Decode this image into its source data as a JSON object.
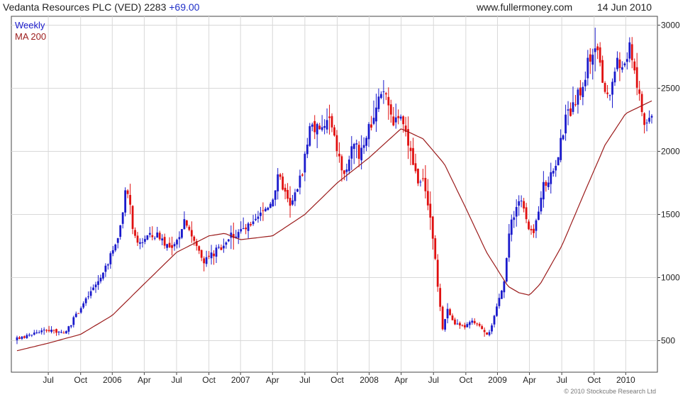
{
  "header": {
    "title": "Vedanta Resources PLC (VED) 2283",
    "change": "+69.00",
    "website": "www.fullermoney.com",
    "date": "14 Jun 2010"
  },
  "colors": {
    "up": "#1a1acc",
    "down": "#e01010",
    "ma": "#9b1b1b",
    "grid": "#d8d8d8",
    "axis": "#444444"
  },
  "chart_data": {
    "type": "candlestick",
    "legend": [
      {
        "label": "Weekly",
        "color": "#1a1acc"
      },
      {
        "label": "MA 200",
        "color": "#9b1b1b"
      }
    ],
    "y_ticks": [
      500,
      1000,
      1500,
      2000,
      2500,
      3000
    ],
    "ylim": [
      250,
      3070
    ],
    "x_ticks": [
      "Jul",
      "Oct",
      "2006",
      "Apr",
      "Jul",
      "Oct",
      "2007",
      "Apr",
      "Jul",
      "Oct",
      "2008",
      "Apr",
      "Jul",
      "Oct",
      "2009",
      "Apr",
      "Jul",
      "Oct",
      "2010",
      "Apr"
    ],
    "x_start": "2005-07-04",
    "x_end": "2010-06-14",
    "price_path": [
      [
        "2005-07-04",
        510
      ],
      [
        "2005-09-01",
        570
      ],
      [
        "2005-10-10",
        590
      ],
      [
        "2005-11-15",
        550
      ],
      [
        "2006-01-10",
        800
      ],
      [
        "2006-03-10",
        1050
      ],
      [
        "2006-04-20",
        1350
      ],
      [
        "2006-05-12",
        1700
      ],
      [
        "2006-06-08",
        1250
      ],
      [
        "2006-07-10",
        1330
      ],
      [
        "2006-08-15",
        1330
      ],
      [
        "2006-09-20",
        1200
      ],
      [
        "2006-10-25",
        1480
      ],
      [
        "2006-11-20",
        1280
      ],
      [
        "2006-12-20",
        1140
      ],
      [
        "2007-01-25",
        1220
      ],
      [
        "2007-03-10",
        1350
      ],
      [
        "2007-05-01",
        1400
      ],
      [
        "2007-06-25",
        1600
      ],
      [
        "2007-07-20",
        1800
      ],
      [
        "2007-08-20",
        1550
      ],
      [
        "2007-09-20",
        1800
      ],
      [
        "2007-10-20",
        2250
      ],
      [
        "2007-11-10",
        2150
      ],
      [
        "2007-12-10",
        2250
      ],
      [
        "2008-01-20",
        1800
      ],
      [
        "2008-02-10",
        2000
      ],
      [
        "2008-03-05",
        2000
      ],
      [
        "2008-04-10",
        2250
      ],
      [
        "2008-05-15",
        2500
      ],
      [
        "2008-06-05",
        2250
      ],
      [
        "2008-06-25",
        2300
      ],
      [
        "2008-07-15",
        2100
      ],
      [
        "2008-08-15",
        1800
      ],
      [
        "2008-09-10",
        1700
      ],
      [
        "2008-10-01",
        1300
      ],
      [
        "2008-10-15",
        850
      ],
      [
        "2008-10-27",
        600
      ],
      [
        "2008-11-10",
        750
      ],
      [
        "2008-11-25",
        650
      ],
      [
        "2008-12-20",
        600
      ],
      [
        "2009-01-20",
        650
      ],
      [
        "2009-02-15",
        600
      ],
      [
        "2009-03-05",
        550
      ],
      [
        "2009-03-25",
        700
      ],
      [
        "2009-04-20",
        1000
      ],
      [
        "2009-05-10",
        1450
      ],
      [
        "2009-06-05",
        1650
      ],
      [
        "2009-07-01",
        1350
      ],
      [
        "2009-07-15",
        1350
      ],
      [
        "2009-08-05",
        1700
      ],
      [
        "2009-09-01",
        1800
      ],
      [
        "2009-09-25",
        2000
      ],
      [
        "2009-10-15",
        2300
      ],
      [
        "2009-11-10",
        2350
      ],
      [
        "2009-12-15",
        2700
      ],
      [
        "2010-01-05",
        2850
      ],
      [
        "2010-01-25",
        2550
      ],
      [
        "2010-02-10",
        2400
      ],
      [
        "2010-03-01",
        2650
      ],
      [
        "2010-04-01",
        2700
      ],
      [
        "2010-04-15",
        2850
      ],
      [
        "2010-05-05",
        2500
      ],
      [
        "2010-05-25",
        2200
      ],
      [
        "2010-06-14",
        2283
      ]
    ],
    "ma200": [
      [
        "2005-07-04",
        420
      ],
      [
        "2005-10-01",
        480
      ],
      [
        "2006-01-01",
        550
      ],
      [
        "2006-04-01",
        700
      ],
      [
        "2006-07-01",
        950
      ],
      [
        "2006-10-01",
        1200
      ],
      [
        "2007-01-01",
        1330
      ],
      [
        "2007-02-15",
        1350
      ],
      [
        "2007-04-01",
        1300
      ],
      [
        "2007-07-01",
        1330
      ],
      [
        "2007-10-01",
        1500
      ],
      [
        "2008-01-01",
        1750
      ],
      [
        "2008-04-01",
        1950
      ],
      [
        "2008-07-01",
        2180
      ],
      [
        "2008-09-01",
        2100
      ],
      [
        "2008-11-01",
        1900
      ],
      [
        "2009-01-01",
        1550
      ],
      [
        "2009-03-01",
        1200
      ],
      [
        "2009-05-01",
        930
      ],
      [
        "2009-06-01",
        880
      ],
      [
        "2009-07-01",
        860
      ],
      [
        "2009-08-01",
        950
      ],
      [
        "2009-10-01",
        1250
      ],
      [
        "2009-12-01",
        1650
      ],
      [
        "2010-02-01",
        2050
      ],
      [
        "2010-04-01",
        2300
      ],
      [
        "2010-06-14",
        2400
      ]
    ],
    "copyright": "© 2010 Stockcube Research Ltd"
  }
}
